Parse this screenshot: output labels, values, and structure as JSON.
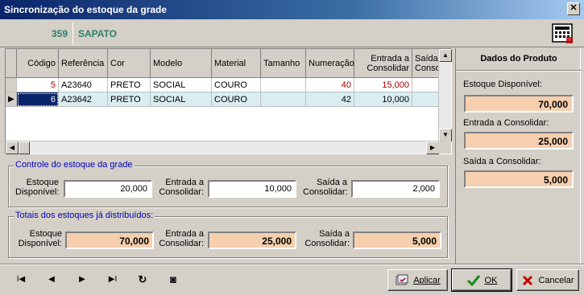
{
  "window": {
    "title": "Sincronização do estoque da grade",
    "close_label": "✕"
  },
  "product": {
    "code": "359",
    "name": "SAPATO"
  },
  "grid": {
    "columns": [
      "Código",
      "Referência",
      "Cor",
      "Modelo",
      "Material",
      "Tamanho",
      "Numeração",
      "Entrada a Consolidar",
      "Saída a Consolidar"
    ],
    "rows": [
      {
        "codigo": "5",
        "referencia": "A23640",
        "cor": "PRETO",
        "modelo": "SOCIAL",
        "material": "COURO",
        "tamanho": "",
        "numeracao": "40",
        "entrada": "15,000",
        "saida": ""
      },
      {
        "codigo": "6",
        "referencia": "A23642",
        "cor": "PRETO",
        "modelo": "SOCIAL",
        "material": "COURO",
        "tamanho": "",
        "numeracao": "42",
        "entrada": "10,000",
        "saida": ""
      }
    ],
    "row_indicator": "▶"
  },
  "controle": {
    "title": "Controle do estoque da grade",
    "estoque_label": "Estoque Disponível:",
    "estoque_value": "20,000",
    "entrada_label": "Entrada a Consolidar:",
    "entrada_value": "10,000",
    "saida_label": "Saída a Consolidar:",
    "saida_value": "2,000"
  },
  "totais": {
    "title": "Totais dos estoques já distribuídos:",
    "estoque_label": "Estoque Disponível:",
    "estoque_value": "70,000",
    "entrada_label": "Entrada a Consolidar:",
    "entrada_value": "25,000",
    "saida_label": "Saída a Consolidar:",
    "saida_value": "5,000"
  },
  "dados_produto": {
    "title": "Dados do Produto",
    "estoque_label": "Estoque Disponível:",
    "estoque_value": "70,000",
    "entrada_label": "Entrada a Consolidar:",
    "entrada_value": "25,000",
    "saida_label": "Saída a Consolidar:",
    "saida_value": "5,000"
  },
  "navigation": {
    "first": "I◀",
    "prev": "◀",
    "next": "▶",
    "last": "▶I",
    "refresh": "↻",
    "record": "◙"
  },
  "buttons": {
    "aplicar": "Aplicar",
    "ok": "OK",
    "cancelar": "Cancelar"
  },
  "colors": {
    "peach": "#f5cfae",
    "teal": "#2e7d6e",
    "selected_row": "#d8eef0",
    "group_title": "#0000c0"
  }
}
